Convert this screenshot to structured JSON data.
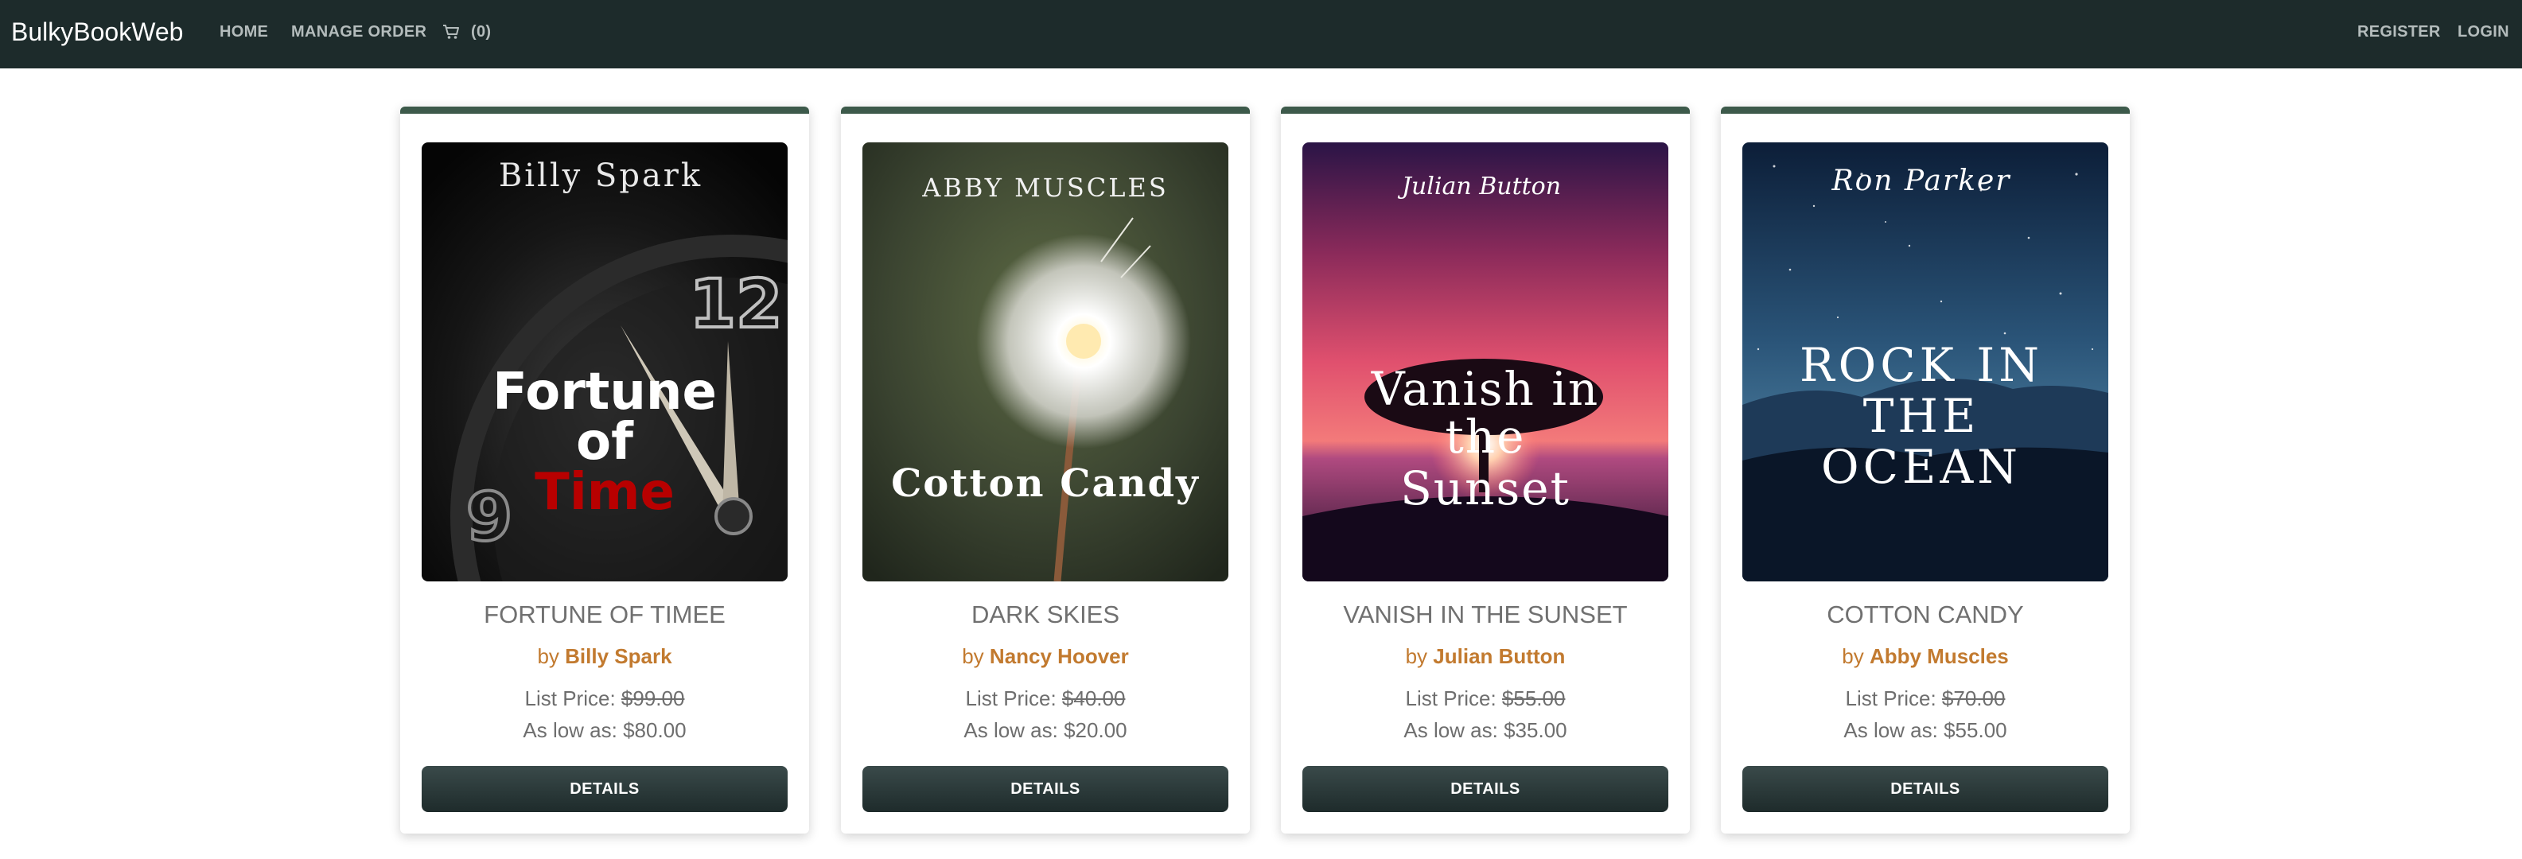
{
  "navbar": {
    "brand": "BulkyBookWeb",
    "links": {
      "home": "HOME",
      "manage_order": "MANAGE ORDER",
      "cart_count": "(0)",
      "register": "REGISTER",
      "login": "LOGIN"
    },
    "background": "#1d2b2b"
  },
  "products": [
    {
      "title": "FORTUNE OF TIMEE",
      "by": "by",
      "author": "Billy Spark",
      "list_price_label": "List Price:",
      "list_price": "$99.00",
      "low_price_text": "As low as: $80.00",
      "button": "DETAILS",
      "cover": {
        "author_text": "Billy Spark",
        "line1": "Fortune",
        "line2": "of",
        "line3": "Time",
        "clock_numerals": [
          "12",
          "9"
        ]
      }
    },
    {
      "title": "DARK SKIES",
      "by": "by",
      "author": "Nancy Hoover",
      "list_price_label": "List Price:",
      "list_price": "$40.00",
      "low_price_text": "As low as: $20.00",
      "button": "DETAILS",
      "cover": {
        "author_text": "ABBY MUSCLES",
        "line1": "Cotton Candy"
      }
    },
    {
      "title": "VANISH IN THE SUNSET",
      "by": "by",
      "author": "Julian Button",
      "list_price_label": "List Price:",
      "list_price": "$55.00",
      "low_price_text": "As low as: $35.00",
      "button": "DETAILS",
      "cover": {
        "author_text": "Julian Button",
        "line1": "Vanish in",
        "line2": "the",
        "line3": "Sunset"
      }
    },
    {
      "title": "COTTON CANDY",
      "by": "by",
      "author": "Abby Muscles",
      "list_price_label": "List Price:",
      "list_price": "$70.00",
      "low_price_text": "As low as: $55.00",
      "button": "DETAILS",
      "cover": {
        "author_text": "Ron Parker",
        "line1": "ROCK IN",
        "line2": "THE",
        "line3": "OCEAN"
      }
    }
  ],
  "colors": {
    "card_accent": "#3d5a4b",
    "author_orange": "#c27a2f",
    "button_dark": "#1e2b2b"
  }
}
